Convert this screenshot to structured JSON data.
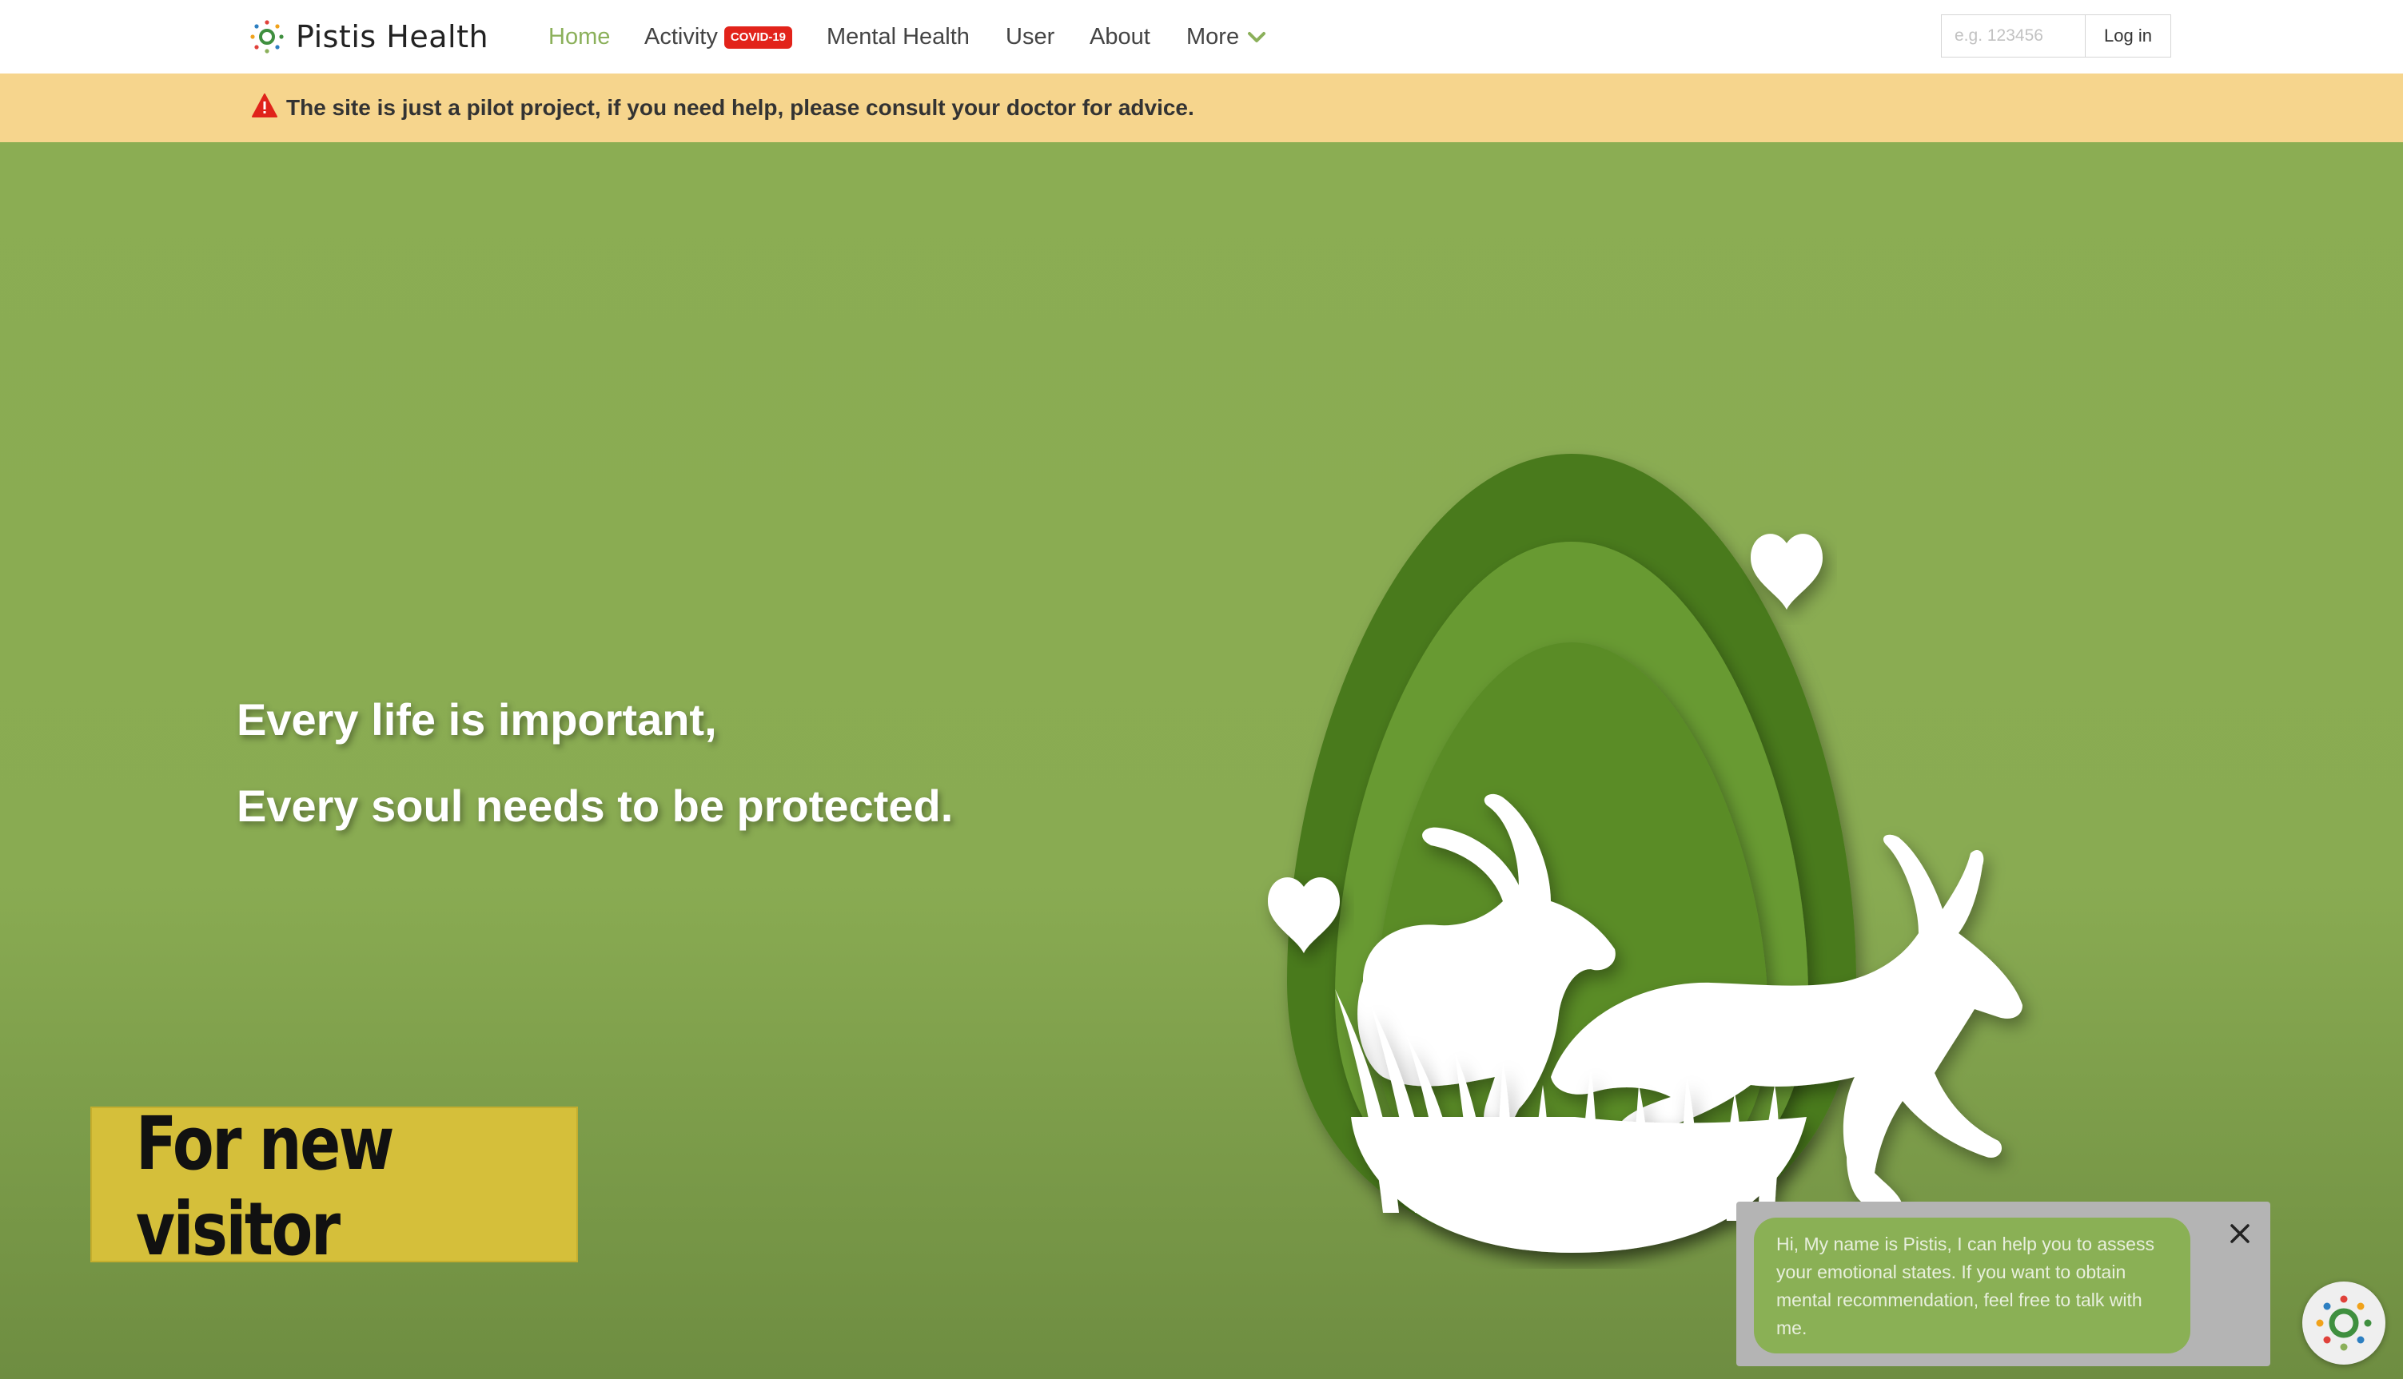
{
  "brand": {
    "name": "Pistis Health",
    "logo_icon": "pistis-sun-logo-icon",
    "accent_color": "#8bb05a"
  },
  "nav": {
    "home": "Home",
    "activity": "Activity",
    "activity_badge": "COVID-19",
    "mental_health": "Mental Health",
    "user": "User",
    "about": "About",
    "more": "More",
    "more_icon": "chevron-down-icon"
  },
  "login": {
    "placeholder": "e.g. 123456",
    "value": "",
    "button": "Log in"
  },
  "alert": {
    "icon": "warning-triangle-icon",
    "text": "The site is just a pilot project, if you need help, please consult your doctor for advice.",
    "background": "#f6d58d"
  },
  "hero": {
    "line1": "Every life is important,",
    "line2": "Every soul needs to be protected.",
    "background": "#8bad53",
    "illustration_icon": "easter-egg-rabbits-illustration"
  },
  "visitor_banner": {
    "text": "For new visitor",
    "background": "#d5bf3a"
  },
  "chat": {
    "message": "Hi, My name is Pistis, I can help you to assess your emotional states. If you want to obtain mental recommendation, feel free to talk with me.",
    "close_icon": "close-icon",
    "launcher_icon": "chatbot-logo-icon"
  }
}
